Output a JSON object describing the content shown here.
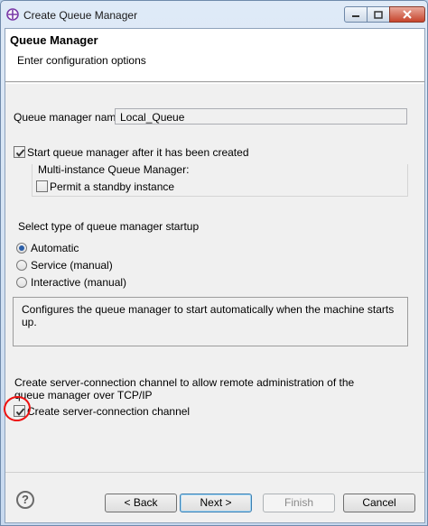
{
  "window": {
    "title": "Create Queue Manager"
  },
  "header": {
    "title": "Queue Manager",
    "subtitle": "Enter configuration options"
  },
  "form": {
    "name_label": "Queue manager name:",
    "name_value": "Local_Queue",
    "start_after_label": "Start queue manager after it has been created",
    "start_after_checked": true,
    "multi_instance_label": "Multi-instance Queue Manager:",
    "permit_standby_label": "Permit a standby instance",
    "permit_standby_checked": false,
    "startup_label": "Select type of queue manager startup",
    "startup_options": [
      "Automatic",
      "Service (manual)",
      "Interactive (manual)"
    ],
    "startup_selected": "Automatic",
    "startup_description": "Configures the queue manager to start automatically when the machine starts up.",
    "channel_text_line1": "Create server-connection channel to allow remote administration of the",
    "channel_text_line2": "queue manager over TCP/IP",
    "channel_checkbox_label": "Create server-connection channel",
    "channel_checkbox_checked": true
  },
  "buttons": {
    "back": "< Back",
    "next": "Next >",
    "finish": "Finish",
    "cancel": "Cancel",
    "help": "?"
  },
  "colors": {
    "annotation": "#e11111",
    "radio_selected": "#2a5ea8"
  }
}
